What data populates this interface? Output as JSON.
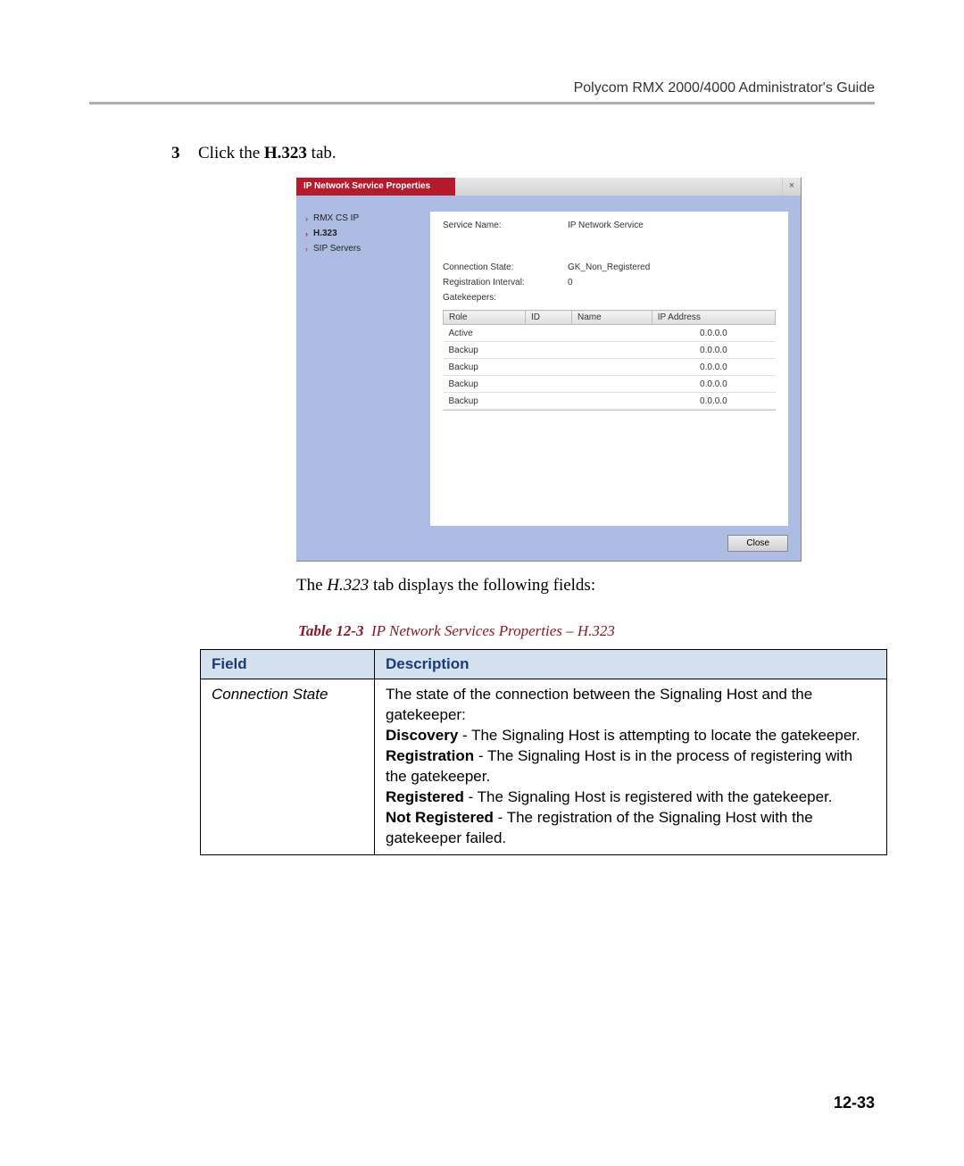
{
  "header": {
    "guide_title": "Polycom RMX 2000/4000 Administrator's Guide"
  },
  "step": {
    "number": "3",
    "prefix": "Click the ",
    "bold": "H.323",
    "suffix": " tab."
  },
  "dialog": {
    "title": "IP Network Service Properties",
    "close_glyph": "×",
    "sidebar": {
      "items": [
        {
          "label": "RMX CS IP"
        },
        {
          "label": "H.323"
        },
        {
          "label": "SIP Servers"
        }
      ]
    },
    "fields": {
      "service_name_label": "Service Name:",
      "service_name_value": "IP Network Service",
      "connection_state_label": "Connection State:",
      "connection_state_value": "GK_Non_Registered",
      "registration_interval_label": "Registration Interval:",
      "registration_interval_value": "0",
      "gatekeepers_label": "Gatekeepers:"
    },
    "gk_table": {
      "headers": {
        "role": "Role",
        "id": "ID",
        "name": "Name",
        "ip": "IP Address"
      },
      "rows": [
        {
          "role": "Active",
          "id": "",
          "name": "",
          "ip": "0.0.0.0"
        },
        {
          "role": "Backup",
          "id": "",
          "name": "",
          "ip": "0.0.0.0"
        },
        {
          "role": "Backup",
          "id": "",
          "name": "",
          "ip": "0.0.0.0"
        },
        {
          "role": "Backup",
          "id": "",
          "name": "",
          "ip": "0.0.0.0"
        },
        {
          "role": "Backup",
          "id": "",
          "name": "",
          "ip": "0.0.0.0"
        }
      ]
    },
    "close_button": "Close"
  },
  "post_screenshot_text": {
    "prefix": "The ",
    "italic": "H.323",
    "suffix": " tab displays the following fields:"
  },
  "caption": {
    "label": "Table 12-3",
    "title": "IP Network Services Properties – H.323"
  },
  "table": {
    "header_field": "Field",
    "header_desc": "Description",
    "row1": {
      "field": "Connection State",
      "line1": "The state of the connection between the Signaling Host and the gatekeeper:",
      "discovery_b": "Discovery",
      "discovery_t": " - The Signaling Host is attempting to locate the gatekeeper.",
      "registration_b": "Registration",
      "registration_t": " - The Signaling Host is in the process of registering with the gatekeeper.",
      "registered_b": "Registered",
      "registered_t": " - The Signaling Host is registered with the gatekeeper.",
      "notreg_b": "Not Registered",
      "notreg_t": " - The registration of the Signaling Host with the gatekeeper failed."
    }
  },
  "page_number": "12-33"
}
